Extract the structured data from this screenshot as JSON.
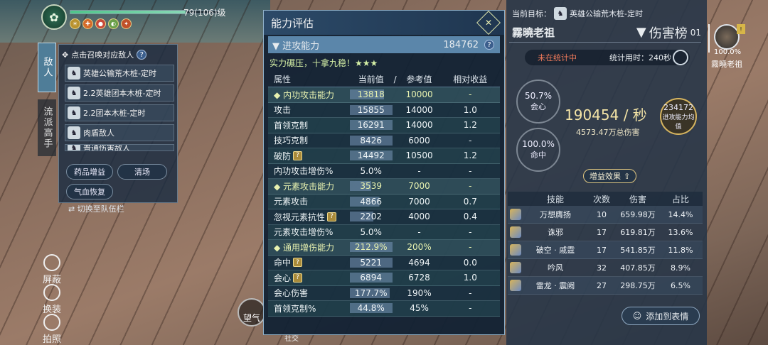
{
  "player": {
    "level_text": "79(106)级",
    "emblem_glyph": "✿",
    "hp_fraction": 0.78,
    "buff_glyphs": [
      "☀",
      "✚",
      "●",
      "◐",
      "✦"
    ]
  },
  "side_tabs": {
    "enemy": "敌人",
    "school": "流派高手"
  },
  "enemy_panel": {
    "header": "点击召唤对应敌人",
    "items": [
      "英雄公输荒木桩-定时",
      "2.2英雄团本木桩-定时",
      "2.2团本木桩-定时",
      "肉盾敌人",
      "普通伤害敌人"
    ],
    "buttons": [
      "药品增益",
      "清场",
      "气血恢复"
    ],
    "switch_team": "切换至队伍栏"
  },
  "left_buttons": [
    "屏蔽",
    "换装",
    "拍照"
  ],
  "wangqi": "望气",
  "social": "社交",
  "assess": {
    "title": "能力评估",
    "close_glyph": "✕",
    "attack_label": "进攻能力",
    "attack_value": "184762",
    "rank_text": "实力碾压，十拿九稳！★★★",
    "headers": [
      "属性",
      "当前值",
      "/",
      "参考值",
      "相对收益"
    ],
    "rows": [
      {
        "name": "◆ 内功攻击能力",
        "cur": "13818",
        "ref": "10000",
        "gain": "-",
        "type": "cat",
        "q": false,
        "cur_fill": 0.8
      },
      {
        "name": "攻击",
        "cur": "15855",
        "ref": "14000",
        "gain": "1.0",
        "type": "plain",
        "q": false,
        "cur_fill": 1
      },
      {
        "name": "首领克制",
        "cur": "16291",
        "ref": "14000",
        "gain": "1.2",
        "type": "alt",
        "q": false,
        "cur_fill": 1
      },
      {
        "name": "技巧克制",
        "cur": "8426",
        "ref": "6000",
        "gain": "-",
        "type": "plain",
        "q": false,
        "cur_fill": 1
      },
      {
        "name": "破防",
        "cur": "14492",
        "ref": "10500",
        "gain": "1.2",
        "type": "alt",
        "q": true,
        "cur_fill": 1
      },
      {
        "name": "内功攻击增伤%",
        "cur": "5.0%",
        "ref": "-",
        "gain": "-",
        "type": "plain",
        "q": false,
        "cur_fill": 0
      },
      {
        "name": "◆ 元素攻击能力",
        "cur": "3539",
        "ref": "7000",
        "gain": "-",
        "type": "cat",
        "q": false,
        "cur_fill": 0.5
      },
      {
        "name": "元素攻击",
        "cur": "4866",
        "ref": "7000",
        "gain": "0.7",
        "type": "alt",
        "q": false,
        "cur_fill": 0.69
      },
      {
        "name": "忽视元素抗性",
        "cur": "2202",
        "ref": "4000",
        "gain": "0.4",
        "type": "plain",
        "q": true,
        "cur_fill": 0.55
      },
      {
        "name": "元素攻击增伤%",
        "cur": "5.0%",
        "ref": "-",
        "gain": "-",
        "type": "alt",
        "q": false,
        "cur_fill": 0
      },
      {
        "name": "◆ 通用增伤能力",
        "cur": "212.9%",
        "ref": "200%",
        "gain": "-",
        "type": "cat",
        "q": false,
        "cur_fill": 1
      },
      {
        "name": "命中",
        "cur": "5221",
        "ref": "4694",
        "gain": "0.0",
        "type": "plain",
        "q": true,
        "cur_fill": 1
      },
      {
        "name": "会心",
        "cur": "6894",
        "ref": "6728",
        "gain": "1.0",
        "type": "alt",
        "q": true,
        "cur_fill": 1
      },
      {
        "name": "会心伤害",
        "cur": "177.7%",
        "ref": "190%",
        "gain": "-",
        "type": "plain",
        "q": false,
        "cur_fill": 0.93
      },
      {
        "name": "首领克制%",
        "cur": "44.8%",
        "ref": "45%",
        "gain": "-",
        "type": "alt",
        "q": false,
        "cur_fill": 1
      }
    ]
  },
  "right": {
    "target_prefix": "当前目标：",
    "target_name": "英雄公输荒木桩-定时",
    "player_name": "霧曉老祖",
    "ranking_label": "伤害榜",
    "ranking_no": "01",
    "status": "未在统计中",
    "time_text": "统计用时：240秒",
    "crit_pct": "50.7%",
    "crit_label": "会心",
    "hit_pct": "100.0%",
    "hit_label": "命中",
    "dps": "190454 / 秒",
    "total": "4573.47万总伤害",
    "avg_value": "234172",
    "avg_label": "进攻能力均值",
    "gain_btn": "增益效果",
    "skill_headers": [
      "技能",
      "次数",
      "伤害",
      "占比"
    ],
    "skills": [
      {
        "name": "万想膺扬",
        "count": "10",
        "dmg": "659.98万",
        "pct": "14.4%"
      },
      {
        "name": "诛邪",
        "count": "17",
        "dmg": "619.81万",
        "pct": "13.6%"
      },
      {
        "name": "破空 · 戚霆",
        "count": "17",
        "dmg": "541.85万",
        "pct": "11.8%"
      },
      {
        "name": "吟风",
        "count": "32",
        "dmg": "407.85万",
        "pct": "8.9%"
      },
      {
        "name": "雷龙 · 震阙",
        "count": "27",
        "dmg": "298.75万",
        "pct": "6.5%"
      }
    ],
    "add_table": "添加到表情"
  },
  "team": {
    "pct": "100.0%",
    "name": "霧曉老祖",
    "badge": "!"
  }
}
